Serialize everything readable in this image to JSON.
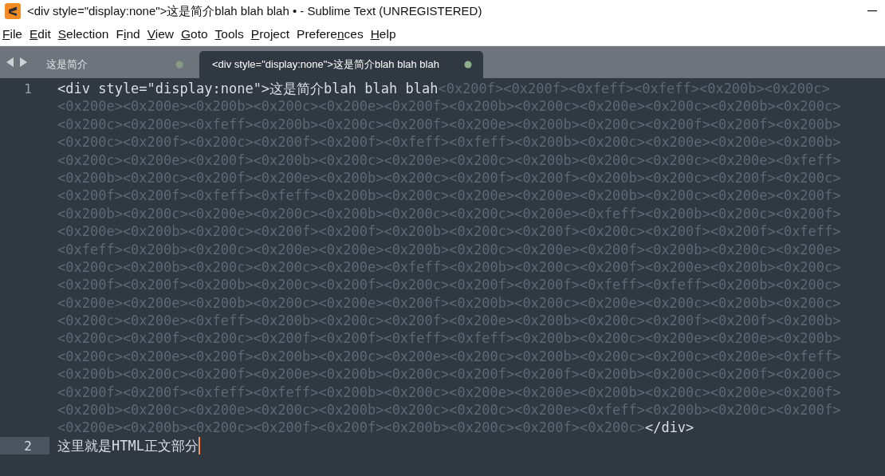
{
  "window": {
    "title": "<div style=\"display:none\">这是简介blah blah blah • - Sublime Text (UNREGISTERED)"
  },
  "menu": [
    {
      "underlined": "F",
      "after": "ile"
    },
    {
      "underlined": "E",
      "after": "dit"
    },
    {
      "underlined": "S",
      "after": "election"
    },
    {
      "before": "F",
      "underlined": "i",
      "after": "nd"
    },
    {
      "underlined": "V",
      "after": "iew"
    },
    {
      "underlined": "G",
      "after": "oto"
    },
    {
      "underlined": "T",
      "after": "ools"
    },
    {
      "underlined": "P",
      "after": "roject"
    },
    {
      "before": "Prefere",
      "underlined": "n",
      "after": "ces"
    },
    {
      "underlined": "H",
      "after": "elp"
    }
  ],
  "tabs": [
    {
      "label": "这是简介",
      "selected": false,
      "dirty": true
    },
    {
      "label": "<div style=\"display:none\">这是简介blah blah blah",
      "selected": true,
      "dirty": true
    }
  ],
  "editor": {
    "lines": [
      {
        "number": "1",
        "current": false,
        "rows": [
          [
            {
              "kind": "code",
              "text": "<div style=\"display:none\">这是简介blah blah blah"
            },
            {
              "kind": "escape",
              "text": "<0x200f><0x200f><0xfeff><0xfeff><0x200b><0x200c>"
            }
          ],
          [
            {
              "kind": "escape",
              "text": "<0x200e><0x200e><0x200b><0x200c><0x200e><0x200f><0x200b><0x200c><0x200e><0x200c><0x200b><0x200c>"
            }
          ],
          [
            {
              "kind": "escape",
              "text": "<0x200c><0x200e><0xfeff><0x200b><0x200c><0x200f><0x200e><0x200b><0x200c><0x200f><0x200f><0x200b>"
            }
          ],
          [
            {
              "kind": "escape",
              "text": "<0x200c><0x200f><0x200c><0x200f><0x200f><0xfeff><0xfeff><0x200b><0x200c><0x200e><0x200e><0x200b>"
            }
          ],
          [
            {
              "kind": "escape",
              "text": "<0x200c><0x200e><0x200f><0x200b><0x200c><0x200e><0x200c><0x200b><0x200c><0x200c><0x200e><0xfeff>"
            }
          ],
          [
            {
              "kind": "escape",
              "text": "<0x200b><0x200c><0x200f><0x200e><0x200b><0x200c><0x200f><0x200f><0x200b><0x200c><0x200f><0x200c>"
            }
          ],
          [
            {
              "kind": "escape",
              "text": "<0x200f><0x200f><0xfeff><0xfeff><0x200b><0x200c><0x200e><0x200e><0x200b><0x200c><0x200e><0x200f>"
            }
          ],
          [
            {
              "kind": "escape",
              "text": "<0x200b><0x200c><0x200e><0x200c><0x200b><0x200c><0x200c><0x200e><0xfeff><0x200b><0x200c><0x200f>"
            }
          ],
          [
            {
              "kind": "escape",
              "text": "<0x200e><0x200b><0x200c><0x200f><0x200f><0x200b><0x200c><0x200f><0x200c><0x200f><0x200f><0xfeff>"
            }
          ],
          [
            {
              "kind": "escape",
              "text": "<0xfeff><0x200b><0x200c><0x200e><0x200e><0x200b><0x200c><0x200e><0x200f><0x200b><0x200c><0x200e>"
            }
          ],
          [
            {
              "kind": "escape",
              "text": "<0x200c><0x200b><0x200c><0x200c><0x200e><0xfeff><0x200b><0x200c><0x200f><0x200e><0x200b><0x200c>"
            }
          ],
          [
            {
              "kind": "escape",
              "text": "<0x200f><0x200f><0x200b><0x200c><0x200f><0x200c><0x200f><0x200f><0xfeff><0xfeff><0x200b><0x200c>"
            }
          ],
          [
            {
              "kind": "escape",
              "text": "<0x200e><0x200e><0x200b><0x200c><0x200e><0x200f><0x200b><0x200c><0x200e><0x200c><0x200b><0x200c>"
            }
          ],
          [
            {
              "kind": "escape",
              "text": "<0x200c><0x200e><0xfeff><0x200b><0x200c><0x200f><0x200e><0x200b><0x200c><0x200f><0x200f><0x200b>"
            }
          ],
          [
            {
              "kind": "escape",
              "text": "<0x200c><0x200f><0x200c><0x200f><0x200f><0xfeff><0xfeff><0x200b><0x200c><0x200e><0x200e><0x200b>"
            }
          ],
          [
            {
              "kind": "escape",
              "text": "<0x200c><0x200e><0x200f><0x200b><0x200c><0x200e><0x200c><0x200b><0x200c><0x200c><0x200e><0xfeff>"
            }
          ],
          [
            {
              "kind": "escape",
              "text": "<0x200b><0x200c><0x200f><0x200e><0x200b><0x200c><0x200f><0x200f><0x200b><0x200c><0x200f><0x200c>"
            }
          ],
          [
            {
              "kind": "escape",
              "text": "<0x200f><0x200f><0xfeff><0xfeff><0x200b><0x200c><0x200e><0x200e><0x200b><0x200c><0x200e><0x200f>"
            }
          ],
          [
            {
              "kind": "escape",
              "text": "<0x200b><0x200c><0x200e><0x200c><0x200b><0x200c><0x200c><0x200e><0xfeff><0x200b><0x200c><0x200f>"
            }
          ],
          [
            {
              "kind": "escape",
              "text": "<0x200e><0x200b><0x200c><0x200f><0x200f><0x200b><0x200c><0x200f><0x200c>"
            },
            {
              "kind": "code",
              "text": "</div>"
            }
          ]
        ]
      },
      {
        "number": "2",
        "current": true,
        "rows": [
          [
            {
              "kind": "code",
              "text": "这里就是HTML正文部分"
            }
          ]
        ]
      }
    ]
  }
}
